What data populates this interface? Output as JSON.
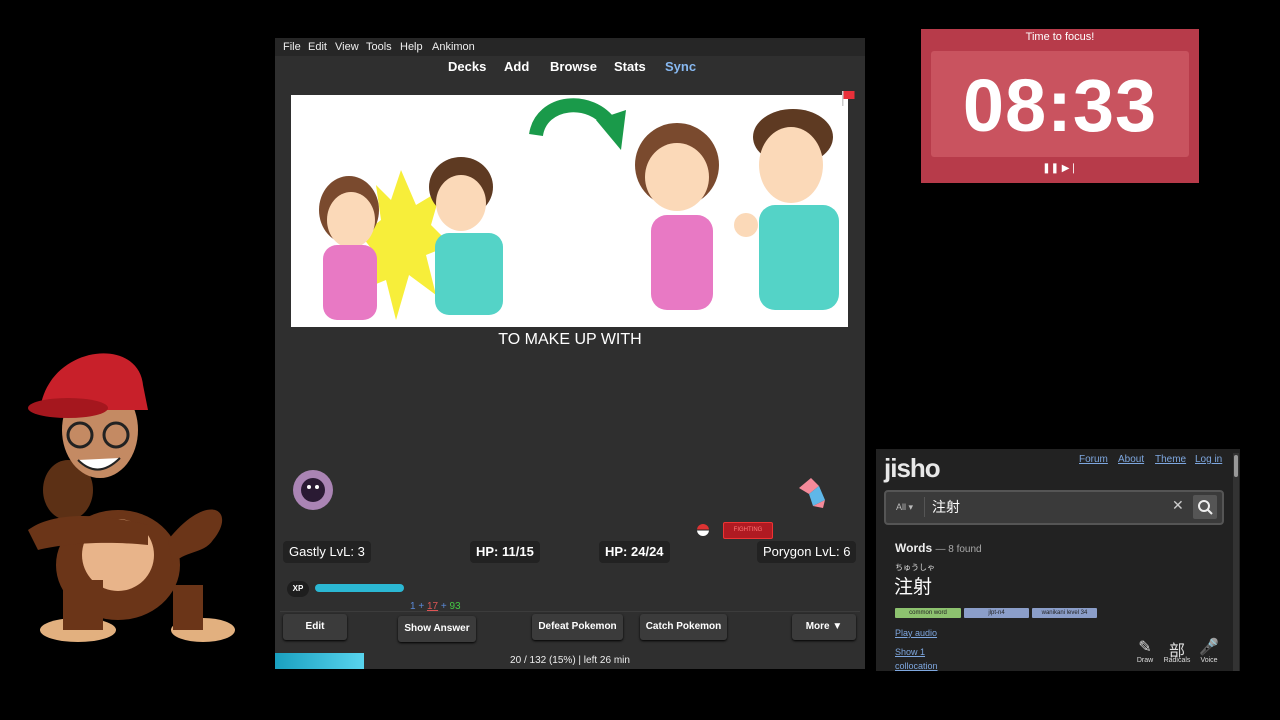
{
  "anki": {
    "menu": [
      "File",
      "Edit",
      "View",
      "Tools",
      "Help",
      "Ankimon"
    ],
    "toolbar": [
      "Decks",
      "Add",
      "Browse",
      "Stats",
      "Sync"
    ],
    "card_text": "TO MAKE UP WITH",
    "battle": {
      "player_name": "Gastly LvL: 3",
      "player_hp": "HP: 11/15",
      "enemy_hp": "HP: 24/24",
      "enemy_name": "Porygon LvL: 6",
      "enemy_type": "FIGHTING",
      "xp_label": "XP",
      "xp_progress": 0.3
    },
    "counts": {
      "new": "1",
      "learn": "17",
      "review": "93",
      "sep": "+"
    },
    "buttons": {
      "edit": "Edit",
      "show_answer": "Show Answer",
      "defeat": "Defeat Pokemon",
      "catch": "Catch Pokemon",
      "more": "More ▼"
    },
    "progress": {
      "text": "20 / 132 (15%) | left 26 min",
      "fraction": 0.15
    }
  },
  "timer": {
    "title": "Time to focus!",
    "time": "08:33",
    "controls": "❚❚ ▶❘"
  },
  "jisho": {
    "logo": "jisho",
    "nav": [
      "Forum",
      "About",
      "Theme",
      "Log in"
    ],
    "search_scope": "All ▾",
    "search_value": "注射",
    "words_title": "Words",
    "words_found": "— 8 found",
    "furigana": "ちゅうしゃ",
    "kanji": "注射",
    "tags": [
      "common word",
      "jlpt-n4",
      "wanikani level 34"
    ],
    "links": {
      "play_audio": "Play audio",
      "show": "Show 1",
      "collocation": "collocation"
    },
    "tools": [
      {
        "glyph": "✎",
        "label": "Draw"
      },
      {
        "glyph": "部",
        "label": "Radicals"
      },
      {
        "glyph": "🎤",
        "label": "Voice"
      }
    ],
    "colors": {
      "tag_common": "#8dc26f",
      "tag_jlpt": "#8b9ec9",
      "tag_wk": "#8b9ec9"
    }
  }
}
